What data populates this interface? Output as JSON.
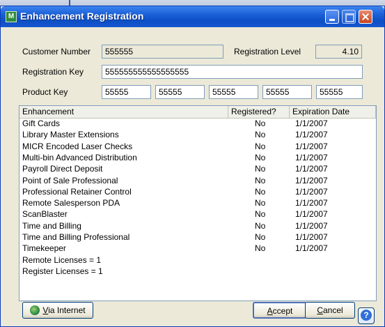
{
  "window": {
    "title": "Enhancement Registration"
  },
  "customer_number": {
    "label": "Customer Number",
    "value": "555555"
  },
  "registration_level": {
    "label": "Registration Level",
    "value": "4.10"
  },
  "registration_key": {
    "label": "Registration Key",
    "value": "555555555555555555"
  },
  "product_key": {
    "label": "Product Key",
    "values": [
      "55555",
      "55555",
      "55555",
      "55555",
      "55555"
    ]
  },
  "list": {
    "columns": [
      "Enhancement",
      "Registered?",
      "Expiration Date"
    ],
    "rows": [
      {
        "name": "Gift Cards",
        "registered": "No",
        "expiration": "1/1/2007"
      },
      {
        "name": "Library Master Extensions",
        "registered": "No",
        "expiration": "1/1/2007"
      },
      {
        "name": "MICR Encoded Laser Checks",
        "registered": "No",
        "expiration": "1/1/2007"
      },
      {
        "name": "Multi-bin Advanced Distribution",
        "registered": "No",
        "expiration": "1/1/2007"
      },
      {
        "name": "Payroll Direct Deposit",
        "registered": "No",
        "expiration": "1/1/2007"
      },
      {
        "name": "Point of Sale Professional",
        "registered": "No",
        "expiration": "1/1/2007"
      },
      {
        "name": "Professional Retainer Control",
        "registered": "No",
        "expiration": "1/1/2007"
      },
      {
        "name": "Remote Salesperson PDA",
        "registered": "No",
        "expiration": "1/1/2007"
      },
      {
        "name": "ScanBlaster",
        "registered": "No",
        "expiration": "1/1/2007"
      },
      {
        "name": "Time and Billing",
        "registered": "No",
        "expiration": "1/1/2007"
      },
      {
        "name": "Time and Billing Professional",
        "registered": "No",
        "expiration": "1/1/2007"
      },
      {
        "name": "Timekeeper",
        "registered": "No",
        "expiration": "1/1/2007"
      },
      {
        "name": "Remote Licenses = 1",
        "registered": "",
        "expiration": ""
      },
      {
        "name": "Register Licenses = 1",
        "registered": "",
        "expiration": ""
      }
    ]
  },
  "buttons": {
    "via_internet_accel": "V",
    "via_internet_rest": "ia Internet",
    "accept_accel": "A",
    "accept_rest": "ccept",
    "cancel_accel": "C",
    "cancel_rest": "ancel",
    "help": "?"
  },
  "colors": {
    "titlebar": "#1b5fd6",
    "dialog_bg": "#ece9d8",
    "field_border": "#7f9db9"
  }
}
